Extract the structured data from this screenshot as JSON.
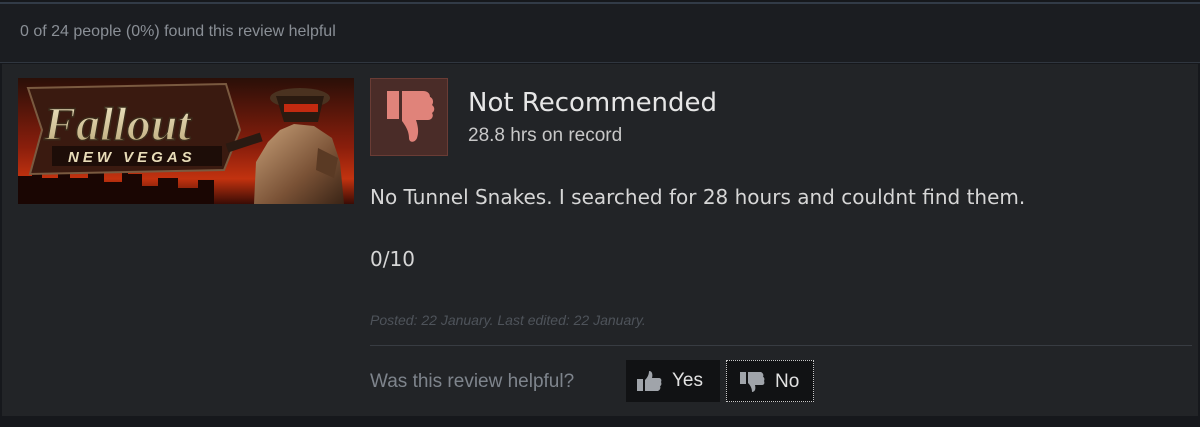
{
  "helpful_summary": "0 of 24 people (0%) found this review helpful",
  "game": {
    "logo_title": "Fallout",
    "logo_subtitle": "NEW VEGAS"
  },
  "review": {
    "verdict": "Not Recommended",
    "verdict_icon": "thumbs-down-icon",
    "hours": "28.8 hrs on record",
    "body_line_1": "No Tunnel Snakes. I searched for 28 hours and couldnt find them.",
    "body_line_2": "0/10",
    "posted": "Posted: 22 January. Last edited: 22 January."
  },
  "feedback": {
    "question": "Was this review helpful?",
    "yes_label": "Yes",
    "no_label": "No",
    "yes_icon": "thumbs-up-icon",
    "no_icon": "thumbs-down-icon"
  },
  "colors": {
    "not_recommended_bg": "#4a2c28",
    "thumb_down": "#e0837a",
    "card_bg": "#222427"
  }
}
